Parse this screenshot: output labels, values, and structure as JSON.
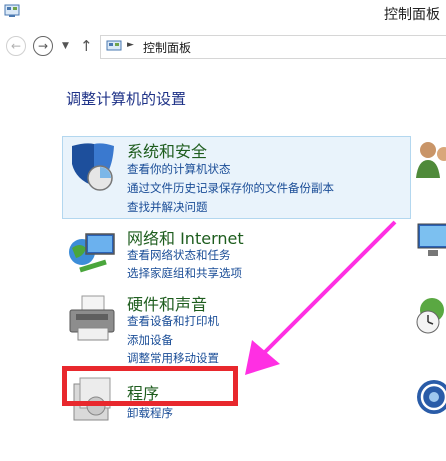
{
  "window": {
    "title": "控制面板"
  },
  "addressbar": {
    "path": "控制面板"
  },
  "heading": "调整计算机的设置",
  "categories": [
    {
      "title": "系统和安全",
      "links": [
        "查看你的计算机状态",
        "通过文件历史记录保存你的文件备份副本",
        "查找并解决问题"
      ],
      "icon": "shield-icon"
    },
    {
      "title": "网络和 Internet",
      "links": [
        "查看网络状态和任务",
        "选择家庭组和共享选项"
      ],
      "icon": "network-globe-icon"
    },
    {
      "title": "硬件和声音",
      "links": [
        "查看设备和打印机",
        "添加设备",
        "调整常用移动设置"
      ],
      "icon": "printer-icon"
    },
    {
      "title": "程序",
      "links": [
        "卸载程序"
      ],
      "icon": "programs-box-icon"
    }
  ],
  "annotation": {
    "highlight_color": "#e8282d",
    "arrow_color": "#ff2fe3"
  }
}
